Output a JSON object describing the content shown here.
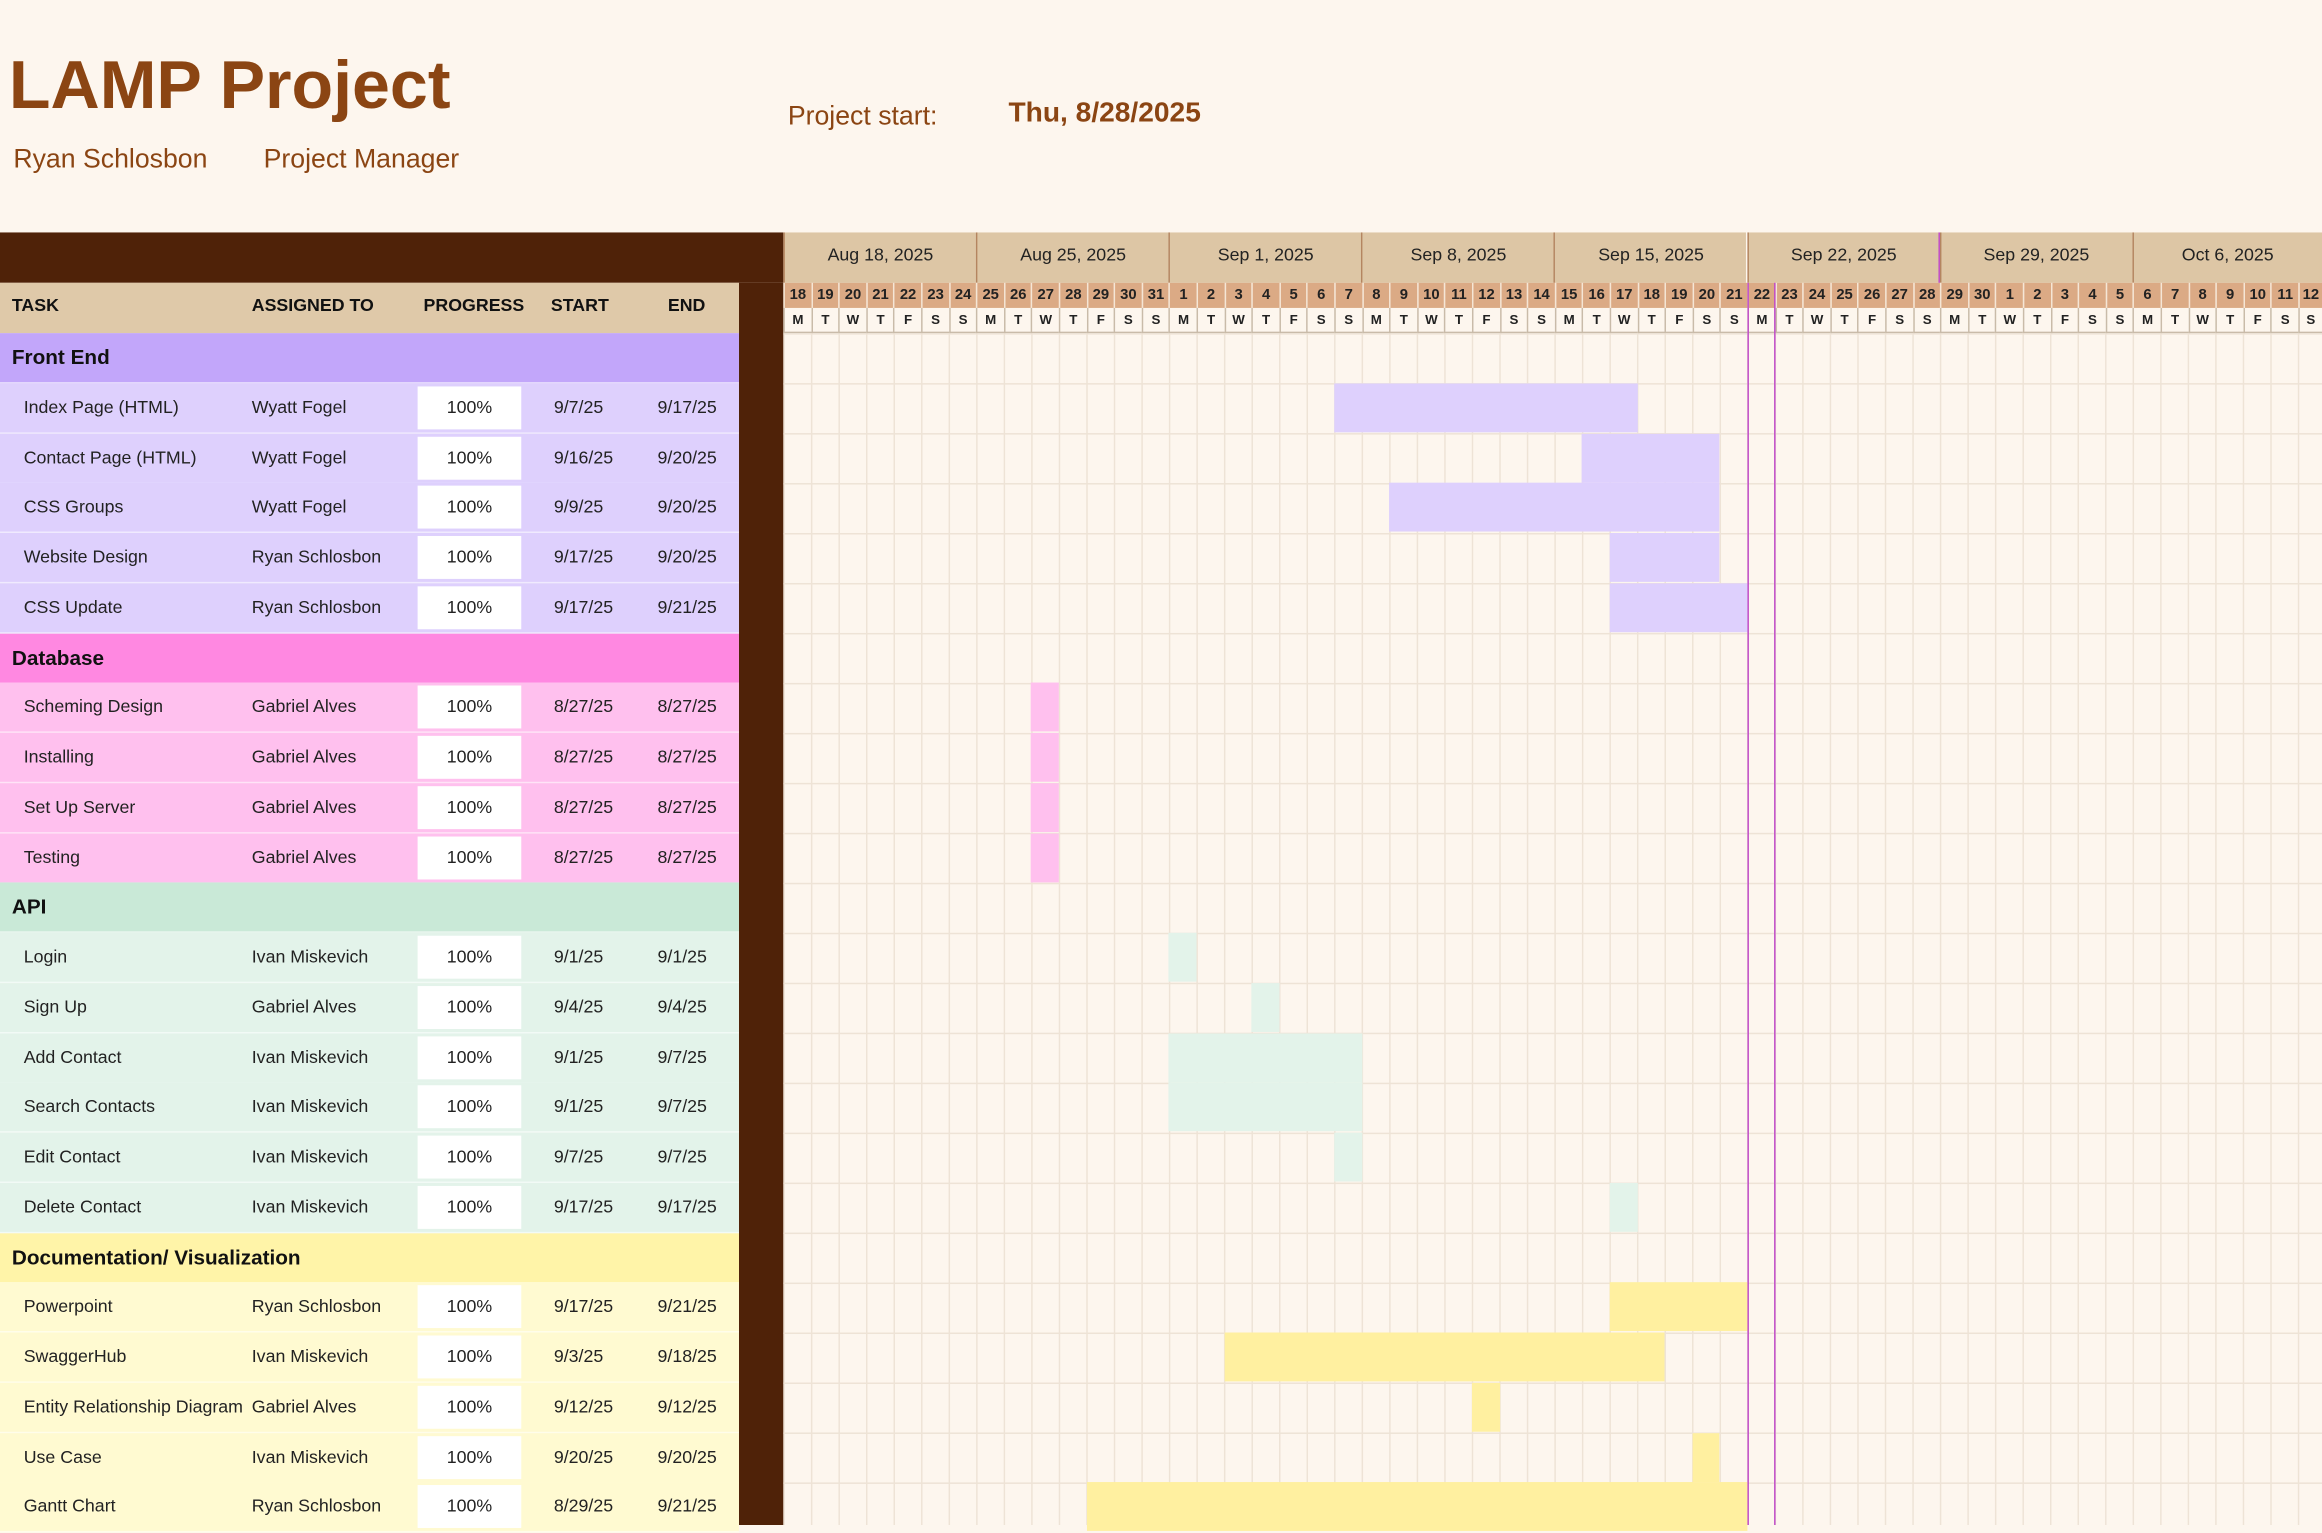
{
  "project": {
    "title": "LAMP Project",
    "start_label": "Project start:",
    "start_value": "Thu, 8/28/2025",
    "manager_name": "Ryan Schlosbon",
    "manager_role": "Project Manager"
  },
  "columns": {
    "task": "TASK",
    "assigned": "ASSIGNED TO",
    "progress": "PROGRESS",
    "start": "START",
    "end": "END"
  },
  "timeline": {
    "weeks": [
      "Aug 18, 2025",
      "Aug 25, 2025",
      "Sep 1, 2025",
      "Sep 8, 2025",
      "Sep 15, 2025",
      "Sep 22, 2025",
      "Sep 29, 2025",
      "Oct 6, 2025"
    ],
    "day_numbers": [
      "18",
      "19",
      "20",
      "21",
      "22",
      "23",
      "24",
      "25",
      "26",
      "27",
      "28",
      "29",
      "30",
      "31",
      "1",
      "2",
      "3",
      "4",
      "5",
      "6",
      "7",
      "8",
      "9",
      "10",
      "11",
      "12",
      "13",
      "14",
      "15",
      "16",
      "17",
      "18",
      "19",
      "20",
      "21",
      "22",
      "23",
      "24",
      "25",
      "26",
      "27",
      "28",
      "29",
      "30",
      "1",
      "2",
      "3",
      "4",
      "5",
      "6",
      "7",
      "8",
      "9",
      "10",
      "11",
      "12"
    ],
    "day_letters": [
      "M",
      "T",
      "W",
      "T",
      "F",
      "S",
      "S",
      "M",
      "T",
      "W",
      "T",
      "F",
      "S",
      "S",
      "M",
      "T",
      "W",
      "T",
      "F",
      "S",
      "S",
      "M",
      "T",
      "W",
      "T",
      "F",
      "S",
      "S",
      "M",
      "T",
      "W",
      "T",
      "F",
      "S",
      "S",
      "M",
      "T",
      "W",
      "T",
      "F",
      "S",
      "S",
      "M",
      "T",
      "W",
      "T",
      "F",
      "S",
      "S",
      "M",
      "T",
      "W",
      "T",
      "F",
      "S",
      "S"
    ],
    "today_day_index": 35
  },
  "groups": [
    {
      "name": "Front End",
      "header_color": "#c2a6fa",
      "row_color": "#ded0fd",
      "bar_color": "#ded0fd",
      "tasks": [
        {
          "task": "Index Page (HTML)",
          "assigned": "Wyatt Fogel",
          "progress": "100%",
          "start": "9/7/25",
          "end": "9/17/25",
          "bar_start_day": 20,
          "bar_days": 11
        },
        {
          "task": "Contact Page (HTML)",
          "assigned": "Wyatt Fogel",
          "progress": "100%",
          "start": "9/16/25",
          "end": "9/20/25",
          "bar_start_day": 29,
          "bar_days": 5
        },
        {
          "task": "CSS Groups",
          "assigned": "Wyatt Fogel",
          "progress": "100%",
          "start": "9/9/25",
          "end": "9/20/25",
          "bar_start_day": 22,
          "bar_days": 12
        },
        {
          "task": "Website Design",
          "assigned": "Ryan Schlosbon",
          "progress": "100%",
          "start": "9/17/25",
          "end": "9/20/25",
          "bar_start_day": 30,
          "bar_days": 4
        },
        {
          "task": "CSS Update",
          "assigned": "Ryan Schlosbon",
          "progress": "100%",
          "start": "9/17/25",
          "end": "9/21/25",
          "bar_start_day": 30,
          "bar_days": 5
        }
      ]
    },
    {
      "name": "Database",
      "header_color": "#ff88e1",
      "row_color": "#ffc0ee",
      "bar_color": "#ffc0ee",
      "tasks": [
        {
          "task": "Scheming Design",
          "assigned": "Gabriel Alves",
          "progress": "100%",
          "start": "8/27/25",
          "end": "8/27/25",
          "bar_start_day": 9,
          "bar_days": 1
        },
        {
          "task": "Installing",
          "assigned": "Gabriel Alves",
          "progress": "100%",
          "start": "8/27/25",
          "end": "8/27/25",
          "bar_start_day": 9,
          "bar_days": 1
        },
        {
          "task": "Set Up Server",
          "assigned": "Gabriel Alves",
          "progress": "100%",
          "start": "8/27/25",
          "end": "8/27/25",
          "bar_start_day": 9,
          "bar_days": 1
        },
        {
          "task": "Testing",
          "assigned": "Gabriel Alves",
          "progress": "100%",
          "start": "8/27/25",
          "end": "8/27/25",
          "bar_start_day": 9,
          "bar_days": 1
        }
      ]
    },
    {
      "name": "API",
      "header_color": "#c9e9d7",
      "row_color": "#e3f3ea",
      "bar_color": "#e3f3ea",
      "tasks": [
        {
          "task": "Login",
          "assigned": "Ivan Miskevich",
          "progress": "100%",
          "start": "9/1/25",
          "end": "9/1/25",
          "bar_start_day": 14,
          "bar_days": 1
        },
        {
          "task": "Sign Up",
          "assigned": "Gabriel Alves",
          "progress": "100%",
          "start": "9/4/25",
          "end": "9/4/25",
          "bar_start_day": 17,
          "bar_days": 1
        },
        {
          "task": "Add Contact",
          "assigned": "Ivan Miskevich",
          "progress": "100%",
          "start": "9/1/25",
          "end": "9/7/25",
          "bar_start_day": 14,
          "bar_days": 7
        },
        {
          "task": "Search Contacts",
          "assigned": "Ivan Miskevich",
          "progress": "100%",
          "start": "9/1/25",
          "end": "9/7/25",
          "bar_start_day": 14,
          "bar_days": 7
        },
        {
          "task": "Edit Contact",
          "assigned": "Ivan Miskevich",
          "progress": "100%",
          "start": "9/7/25",
          "end": "9/7/25",
          "bar_start_day": 20,
          "bar_days": 1
        },
        {
          "task": "Delete Contact",
          "assigned": "Ivan Miskevich",
          "progress": "100%",
          "start": "9/17/25",
          "end": "9/17/25",
          "bar_start_day": 30,
          "bar_days": 1
        }
      ]
    },
    {
      "name": "Documentation/ Visualization",
      "header_color": "#fff4a8",
      "row_color": "#fffad1",
      "bar_color": "#fff0a0",
      "tasks": [
        {
          "task": "Powerpoint",
          "assigned": "Ryan Schlosbon",
          "progress": "100%",
          "start": "9/17/25",
          "end": "9/21/25",
          "bar_start_day": 30,
          "bar_days": 5
        },
        {
          "task": "SwaggerHub",
          "assigned": "Ivan Miskevich",
          "progress": "100%",
          "start": "9/3/25",
          "end": "9/18/25",
          "bar_start_day": 16,
          "bar_days": 16
        },
        {
          "task": "Entity Relationship Diagram",
          "assigned": "Gabriel Alves",
          "progress": "100%",
          "start": "9/12/25",
          "end": "9/12/25",
          "bar_start_day": 25,
          "bar_days": 1
        },
        {
          "task": "Use Case",
          "assigned": "Ivan Miskevich",
          "progress": "100%",
          "start": "9/20/25",
          "end": "9/20/25",
          "bar_start_day": 33,
          "bar_days": 1
        },
        {
          "task": "Gantt Chart",
          "assigned": "Ryan Schlosbon",
          "progress": "100%",
          "start": "8/29/25",
          "end": "9/21/25",
          "bar_start_day": 11,
          "bar_days": 24
        }
      ]
    }
  ]
}
